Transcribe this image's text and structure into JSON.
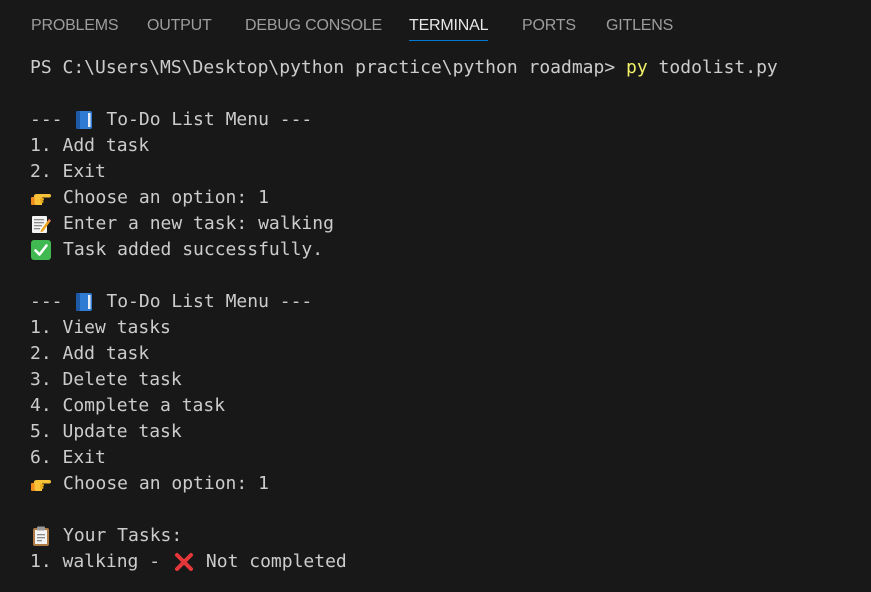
{
  "tabs": [
    {
      "label": "PROBLEMS",
      "active": false
    },
    {
      "label": "OUTPUT",
      "active": false
    },
    {
      "label": "DEBUG CONSOLE",
      "active": false
    },
    {
      "label": "TERMINAL",
      "active": true
    },
    {
      "label": "PORTS",
      "active": false
    },
    {
      "label": "GITLENS",
      "active": false
    }
  ],
  "terminal": {
    "prompt": "PS C:\\Users\\MS\\Desktop\\python practice\\python roadmap> ",
    "command_exe": "py",
    "command_args": " todolist.py",
    "menu1": {
      "title_left": "---",
      "title_right": "To-Do List Menu ---",
      "title_icon": "blue-book-icon",
      "options": [
        "1. Add task",
        "2. Exit"
      ]
    },
    "choose1": {
      "icon": "pointing-hand-icon",
      "text": "Choose an option: 1"
    },
    "enter_task": {
      "icon": "memo-icon",
      "text": "Enter a new task: walking"
    },
    "added": {
      "icon": "check-mark-icon",
      "text": "Task added successfully."
    },
    "menu2": {
      "title_left": "---",
      "title_right": "To-Do List Menu ---",
      "title_icon": "blue-book-icon",
      "options": [
        "1. View tasks",
        "2. Add task",
        "3. Delete task",
        "4. Complete a task",
        "5. Update task",
        "6. Exit"
      ]
    },
    "choose2": {
      "icon": "pointing-hand-icon",
      "text": "Choose an option: 1"
    },
    "your_tasks": {
      "icon": "clipboard-icon",
      "text": "Your Tasks:"
    },
    "task_line": {
      "left": "1. walking -",
      "icon": "cross-mark-icon",
      "right": "Not completed"
    }
  },
  "colors": {
    "background": "#181818",
    "text": "#cccccc",
    "tab_inactive": "#9d9d9d",
    "tab_active": "#e7e7e7",
    "tab_underline": "#0078d4",
    "command_highlight": "#f1f16a"
  }
}
